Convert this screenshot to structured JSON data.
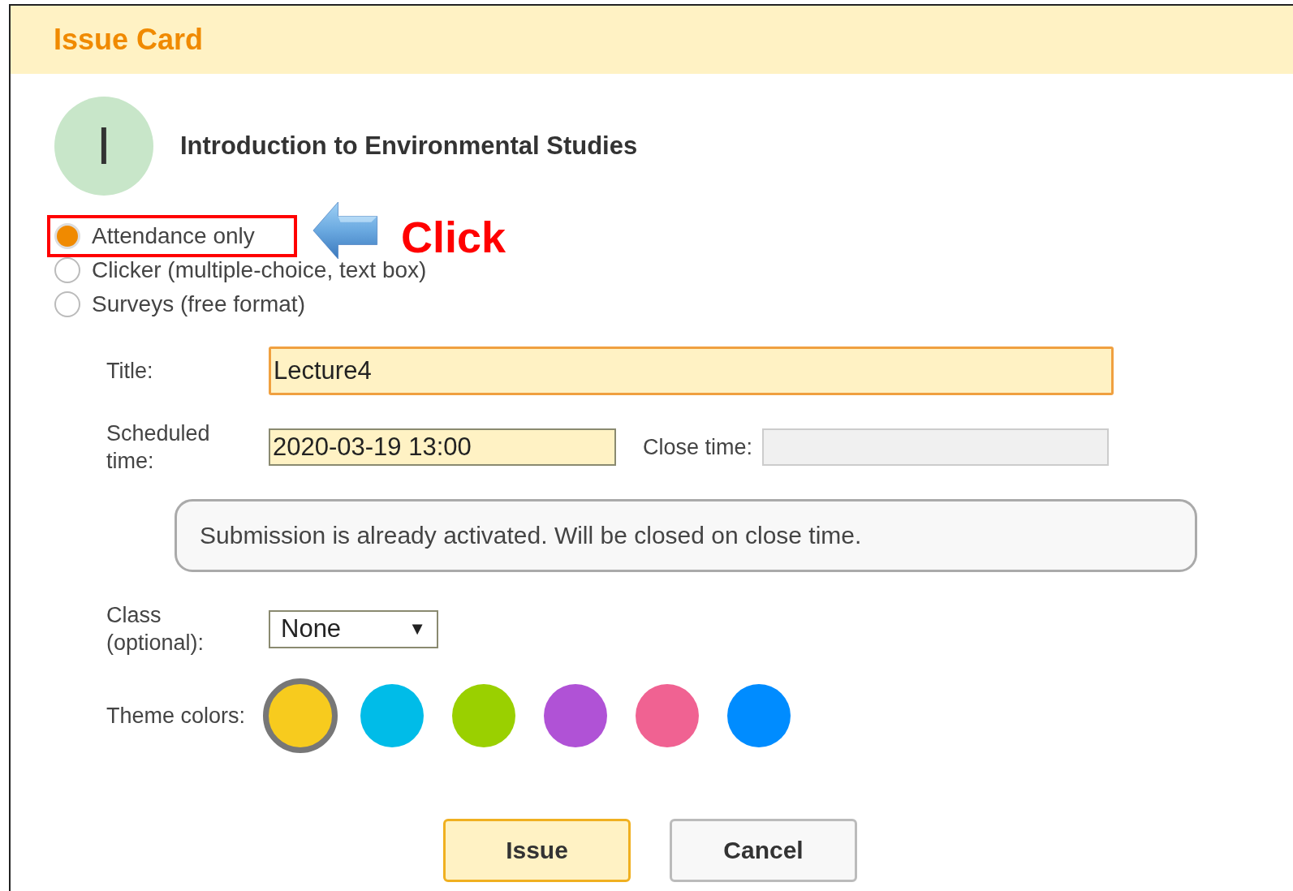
{
  "header": {
    "title": "Issue Card"
  },
  "course": {
    "initial": "I",
    "name": "Introduction to Environmental Studies"
  },
  "modes": [
    {
      "label": "Attendance only",
      "selected": true
    },
    {
      "label": "Clicker (multiple-choice, text box)",
      "selected": false
    },
    {
      "label": "Surveys (free format)",
      "selected": false
    }
  ],
  "annotation": {
    "text": "Click"
  },
  "form": {
    "title_label": "Title:",
    "title_value": "Lecture4",
    "scheduled_label": "Scheduled time:",
    "scheduled_value": "2020-03-19 13:00",
    "close_label": "Close time:",
    "notice": "Submission is already activated. Will be closed on close time.",
    "class_label": "Class (optional):",
    "class_value": "None",
    "class_caret": "▼",
    "theme_label": "Theme colors:"
  },
  "theme_colors": [
    {
      "color": "#f7cb1e",
      "selected": true
    },
    {
      "color": "#00bce8",
      "selected": false
    },
    {
      "color": "#9ad000",
      "selected": false
    },
    {
      "color": "#b052d6",
      "selected": false
    },
    {
      "color": "#f06292",
      "selected": false
    },
    {
      "color": "#008cff",
      "selected": false
    }
  ],
  "buttons": [
    {
      "label": "Issue",
      "kind": "primary"
    },
    {
      "label": "Cancel",
      "kind": "secondary"
    }
  ]
}
